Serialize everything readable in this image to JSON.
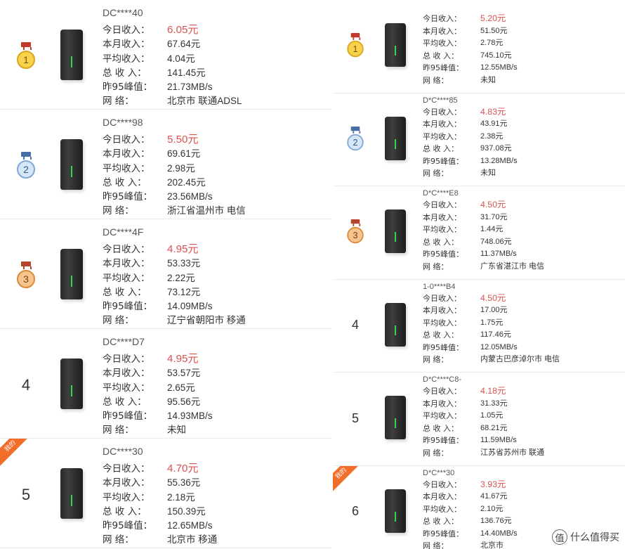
{
  "labels": {
    "today": "今日收入：",
    "month": "本月收入：",
    "average": "平均收入：",
    "total": "总 收 入：",
    "peak95": "昨95峰值：",
    "network": "网      络："
  },
  "left_list": [
    {
      "rank": "1",
      "rank_type": "gold",
      "id": "DC****40",
      "today": "6.05元",
      "month": "67.64元",
      "average": "4.04元",
      "total": "141.45元",
      "peak95": "21.73MB/s",
      "network": "北京市 联通ADSL"
    },
    {
      "rank": "2",
      "rank_type": "silver",
      "id": "DC****98",
      "today": "5.50元",
      "month": "69.61元",
      "average": "2.98元",
      "total": "202.45元",
      "peak95": "23.56MB/s",
      "network": "浙江省温州市 电信"
    },
    {
      "rank": "3",
      "rank_type": "bronze",
      "id": "DC****4F",
      "today": "4.95元",
      "month": "53.33元",
      "average": "2.22元",
      "total": "73.12元",
      "peak95": "14.09MB/s",
      "network": "辽宁省朝阳市 移通"
    },
    {
      "rank": "4",
      "rank_type": "plain",
      "id": "DC****D7",
      "today": "4.95元",
      "month": "53.57元",
      "average": "2.65元",
      "total": "95.56元",
      "peak95": "14.93MB/s",
      "network": "未知"
    },
    {
      "rank": "5",
      "rank_type": "plain",
      "id": "DC****30",
      "today": "4.70元",
      "month": "55.36元",
      "average": "2.18元",
      "total": "150.39元",
      "peak95": "12.65MB/s",
      "network": "北京市 移通",
      "corner_tag": "我的"
    }
  ],
  "right_list": [
    {
      "rank": "1",
      "rank_type": "gold",
      "id": "",
      "today": "5.20元",
      "month": "51.50元",
      "average": "2.78元",
      "total": "745.10元",
      "peak95": "12.55MB/s",
      "network": "未知"
    },
    {
      "rank": "2",
      "rank_type": "silver",
      "id": "D*C****85",
      "today": "4.83元",
      "month": "43.91元",
      "average": "2.38元",
      "total": "937.08元",
      "peak95": "13.28MB/s",
      "network": "未知"
    },
    {
      "rank": "3",
      "rank_type": "bronze",
      "id": "D*C****E8",
      "today": "4.50元",
      "month": "31.70元",
      "average": "1.44元",
      "total": "748.06元",
      "peak95": "11.37MB/s",
      "network": "广东省湛江市 电信"
    },
    {
      "rank": "4",
      "rank_type": "plain",
      "id": "1-0****B4",
      "today": "4.50元",
      "month": "17.00元",
      "average": "1.75元",
      "total": "117.46元",
      "peak95": "12.05MB/s",
      "network": "内蒙古巴彦淖尔市 电信"
    },
    {
      "rank": "5",
      "rank_type": "plain",
      "id": "D*C****C8-",
      "today": "4.18元",
      "month": "31.33元",
      "average": "1.05元",
      "total": "68.21元",
      "peak95": "11.59MB/s",
      "network": "江苏省苏州市 联通"
    },
    {
      "rank": "6",
      "rank_type": "plain",
      "id": "D*C***30",
      "today": "3.93元",
      "month": "41.67元",
      "average": "2.10元",
      "total": "136.76元",
      "peak95": "14.40MB/s",
      "network": "北京市",
      "corner_tag": "我的"
    }
  ],
  "medal_colors": {
    "gold": {
      "disc": "#f7d24a",
      "border": "#d9a520",
      "ribbon": "#c0392b",
      "text": "#7a5300"
    },
    "silver": {
      "disc": "#d6e6f7",
      "border": "#7fa7d6",
      "ribbon": "#4a6fa5",
      "text": "#2f5a8c"
    },
    "bronze": {
      "disc": "#f6c48d",
      "border": "#d98a3a",
      "ribbon": "#b5452a",
      "text": "#7a3f10"
    }
  },
  "watermark": {
    "badge": "值",
    "text": "什么值得买"
  }
}
